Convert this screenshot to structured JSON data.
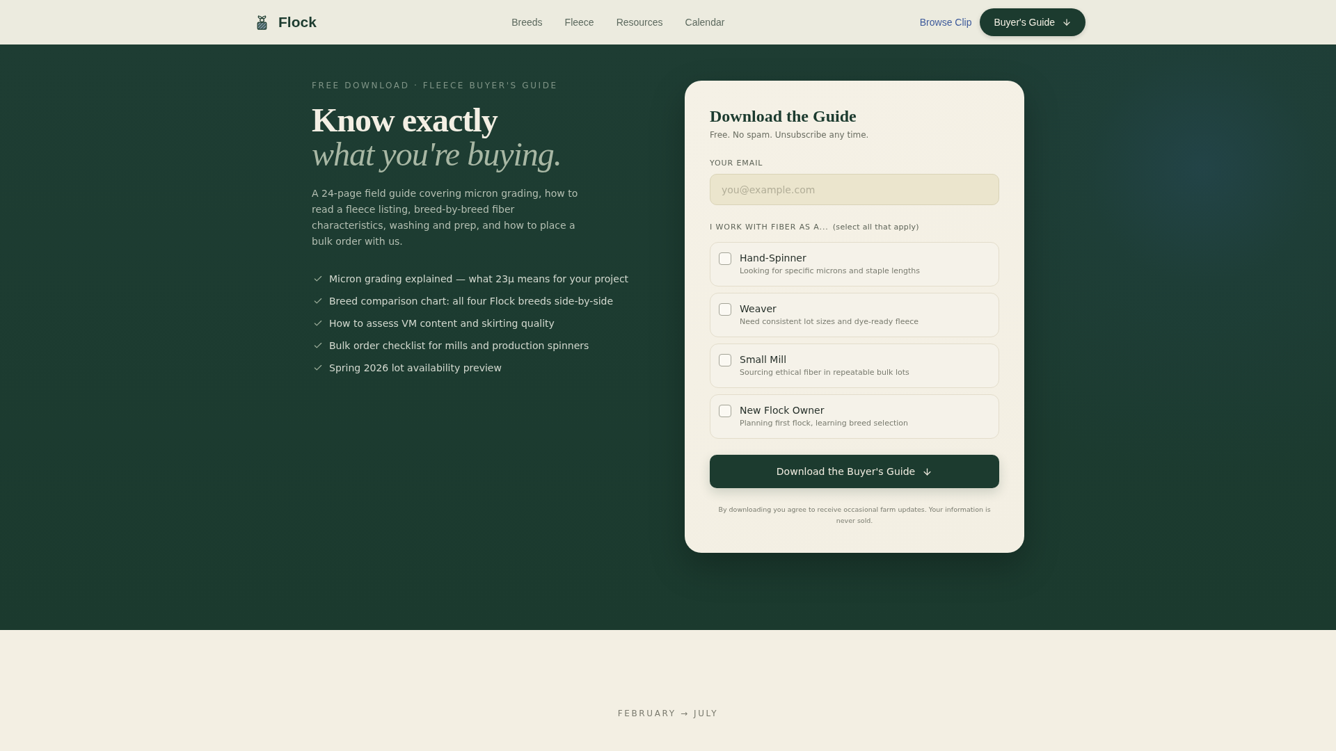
{
  "nav": {
    "brand": "Flock",
    "links": [
      "Breeds",
      "Fleece",
      "Resources",
      "Calendar"
    ],
    "secondary_link": "Browse Clip",
    "cta": "Buyer's Guide"
  },
  "hero": {
    "eyebrow": "FREE DOWNLOAD · FLEECE BUYER'S GUIDE",
    "title": "Know exactly",
    "title_accent": "what you're buying.",
    "description": "A 24-page field guide covering micron grading, how to read a fleece listing, breed-by-breed fiber characteristics, washing and prep, and how to place a bulk order with us.",
    "features": [
      "Micron grading explained — what 23µ means for your project",
      "Breed comparison chart: all four Flock breeds side-by-side",
      "How to assess VM content and skirting quality",
      "Bulk order checklist for mills and production spinners",
      "Spring 2026 lot availability preview"
    ]
  },
  "form": {
    "title": "Download the Guide",
    "subtitle": "Free. No spam. Unsubscribe any time.",
    "email": {
      "label": "YOUR EMAIL",
      "placeholder": "you@example.com"
    },
    "roles_label": "I WORK WITH FIBER AS A...",
    "roles_hint": "(select all that apply)",
    "roles": [
      {
        "title": "Hand-Spinner",
        "description": "Looking for specific microns and staple lengths",
        "checked": false
      },
      {
        "title": "Weaver",
        "description": "Need consistent lot sizes and dye-ready fleece",
        "checked": false
      },
      {
        "title": "Small Mill",
        "description": "Sourcing ethical fiber in repeatable bulk lots",
        "checked": false
      },
      {
        "title": "New Flock Owner",
        "description": "Planning first flock, learning breed selection",
        "checked": false
      }
    ],
    "submit": "Download the Buyer's Guide",
    "disclaimer": "By downloading you agree to receive occasional farm updates. Your information is never sold."
  },
  "next_section": {
    "eyebrow": "FEBRUARY → JULY"
  }
}
